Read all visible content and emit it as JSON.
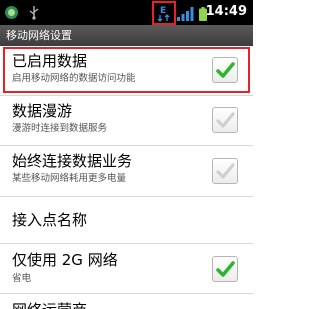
{
  "status_bar": {
    "time": "14:49",
    "colors": {
      "data_icon": "#3a8de0",
      "signal": "#3a8de0",
      "battery": "#8fd44a",
      "highlight": "#e8202a"
    }
  },
  "title_bar": {
    "title": "移动网络设置"
  },
  "settings": [
    {
      "title": "已启用数据",
      "summary": "启用移动网络的数据访问功能",
      "checkbox": "checked"
    },
    {
      "title": "数据漫游",
      "summary": "漫游时连接到数据服务",
      "checkbox": "unchecked-disabled"
    },
    {
      "title": "始终连接数据业务",
      "summary": "某些移动网络耗用更多电量",
      "checkbox": "unchecked-disabled"
    },
    {
      "title": "接入点名称",
      "summary": "",
      "checkbox": "none"
    },
    {
      "title": "仅使用 2G 网络",
      "summary": "省电",
      "checkbox": "checked"
    },
    {
      "title": "网络运营商",
      "summary": "",
      "checkbox": "none"
    }
  ]
}
